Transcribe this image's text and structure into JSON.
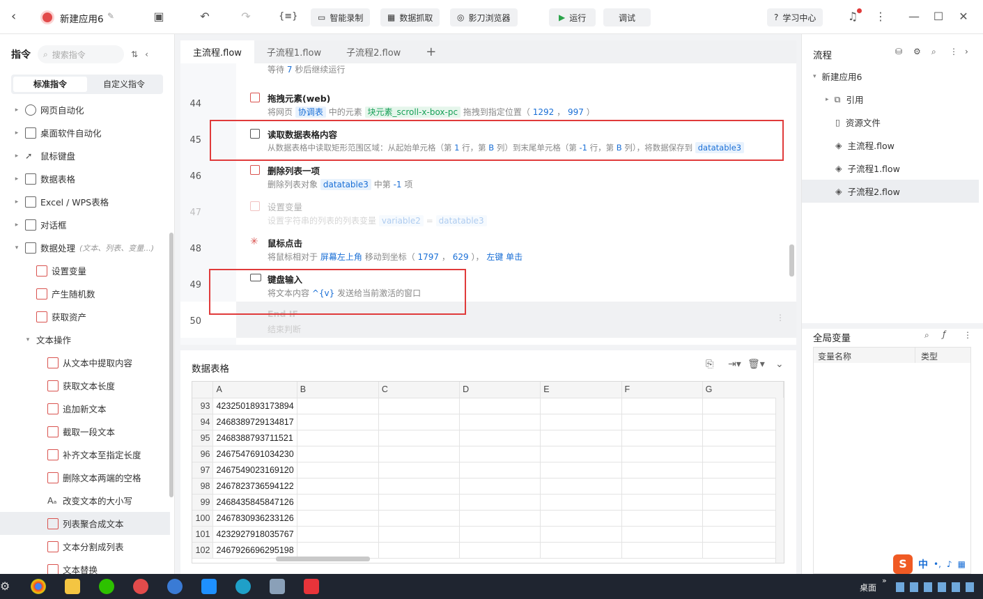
{
  "topbar": {
    "app_name": "新建应用6",
    "buttons": [
      "智能录制",
      "数据抓取",
      "影刀浏览器"
    ],
    "run": "运行",
    "debug": "调试",
    "learn": "学习中心",
    "code_icon": "{≡}"
  },
  "left": {
    "title": "指令",
    "search_placeholder": "搜索指令",
    "seg": [
      "标准指令",
      "自定义指令"
    ],
    "groups": [
      "网页自动化",
      "桌面软件自动化",
      "鼠标键盘",
      "数据表格",
      "Excel / WPS表格",
      "对话框"
    ],
    "data_group": "数据处理",
    "data_group_hint": "(文本、列表、变量...)",
    "data_items": [
      "设置变量",
      "产生随机数",
      "获取资产"
    ],
    "text_group": "文本操作",
    "text_items": [
      "从文本中提取内容",
      "获取文本长度",
      "追加新文本",
      "截取一段文本",
      "补齐文本至指定长度",
      "删除文本两端的空格",
      "改变文本的大小写",
      "列表聚合成文本",
      "文本分割成列表",
      "文本替换"
    ]
  },
  "tabs": [
    "主流程.flow",
    "子流程1.flow",
    "子流程2.flow"
  ],
  "rows": {
    "r43_desc_a": "等待",
    "r43_num": "7",
    "r43_desc_b": "秒后继续运行",
    "r44": {
      "no": "44",
      "title": "拖拽元素(web)",
      "d1": "将网页",
      "v1": "协调表",
      "d2": "中的元素",
      "v2": "块元素_scroll-x-box-pc",
      "d3": "拖拽到指定位置（",
      "v3": "1292",
      "d4": "，",
      "v4": "997",
      "d5": "）"
    },
    "r45": {
      "no": "45",
      "title": "读取数据表格内容",
      "d1": "从数据表格中读取矩形范围区域：从起始单元格（第",
      "v1": "1",
      "d2": "行，第",
      "v2": "B",
      "d3": "列）到末尾单元格（第",
      "v3": "-1",
      "d4": "行，第",
      "v4": "B",
      "d5": "列），将数据保存到",
      "v5": "datatable3"
    },
    "r46": {
      "no": "46",
      "title": "删除列表一项",
      "d1": "删除列表对象",
      "v1": "datatable3",
      "d2": "中第",
      "v2": "-1",
      "d3": "项"
    },
    "r47": {
      "no": "47",
      "title": "设置变量",
      "d1": "设置字符串的列表的列表变量",
      "v1": "variable2",
      "d2": "=",
      "v2": "datatable3"
    },
    "r48": {
      "no": "48",
      "title": "鼠标点击",
      "d1": "将鼠标相对于",
      "v1": "屏幕左上角",
      "d2": "移动到坐标（",
      "v2": "1797",
      "d3": "，",
      "v3": "629",
      "d4": "），",
      "v4": "左键 单击"
    },
    "r49": {
      "no": "49",
      "title": "键盘输入",
      "d1": "将文本内容",
      "v1": "^{v}",
      "d2": "发送给当前激活的窗口"
    },
    "r50": {
      "no": "50",
      "title": "End IF",
      "d1": "结束判断"
    }
  },
  "right": {
    "flow_title": "流程",
    "items": [
      "新建应用6",
      "引用",
      "资源文件",
      "主流程.flow",
      "子流程1.flow",
      "子流程2.flow"
    ],
    "var_title": "全局变量",
    "var_cols": [
      "变量名称",
      "类型"
    ]
  },
  "table": {
    "title": "数据表格",
    "cols": [
      "A",
      "B",
      "C",
      "D",
      "E",
      "F",
      "G"
    ],
    "rows": [
      [
        "93",
        "4232501893173894"
      ],
      [
        "94",
        "2468389729134817"
      ],
      [
        "95",
        "2468388793711521"
      ],
      [
        "96",
        "2467547691034230"
      ],
      [
        "97",
        "2467549023169120"
      ],
      [
        "98",
        "2467823736594122"
      ],
      [
        "99",
        "2468435845847126"
      ],
      [
        "100",
        "2467830936233126"
      ],
      [
        "101",
        "4232927918035767"
      ],
      [
        "102",
        "2467926696295198"
      ]
    ]
  },
  "taskbar": {
    "desktop": "桌面",
    "ime": "中"
  }
}
